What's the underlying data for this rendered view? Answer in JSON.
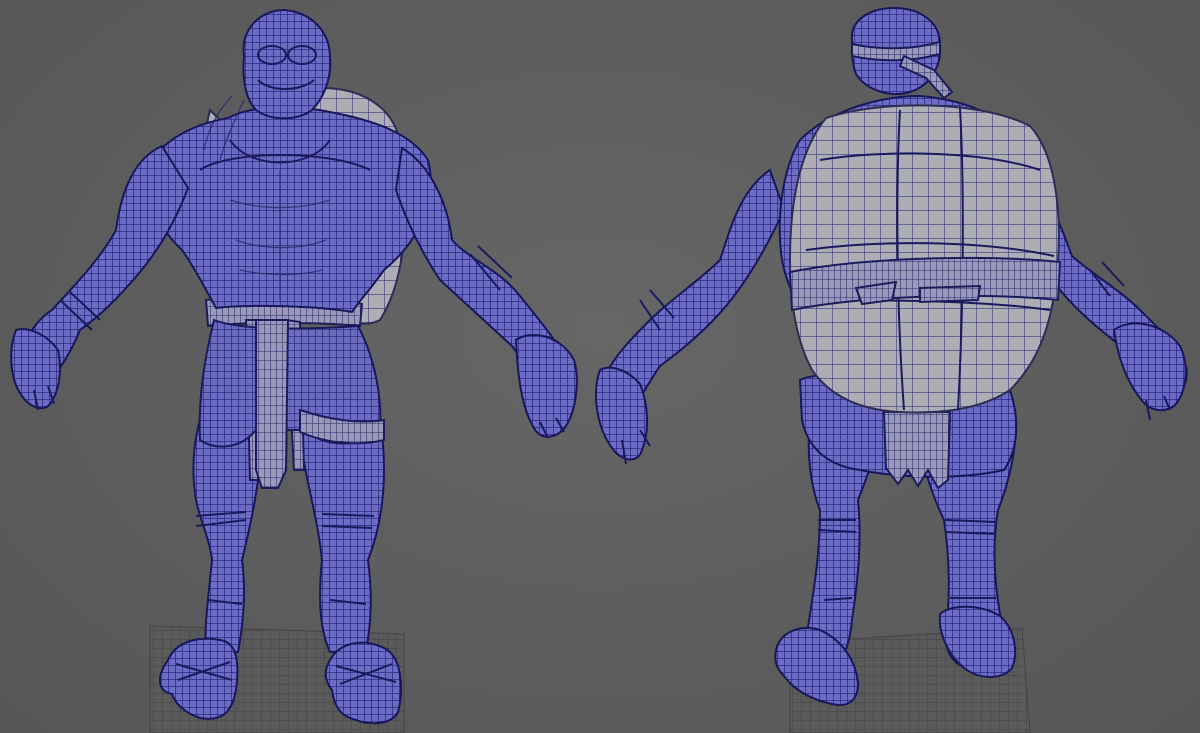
{
  "viewport": {
    "background_color": "#5d5d5d",
    "wireframe_color": "#23237a",
    "shell_color": "#a9a8b0",
    "views": [
      "front",
      "back"
    ],
    "ground_grid": true
  }
}
